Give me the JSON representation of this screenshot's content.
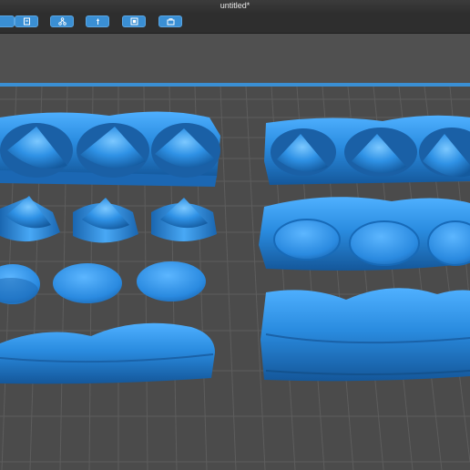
{
  "window": {
    "title": "untitled*"
  },
  "toolbar": {
    "buttons": [
      {
        "icon": "tool-icon"
      },
      {
        "icon": "document-icon"
      },
      {
        "icon": "network-icon"
      },
      {
        "icon": "support-icon"
      },
      {
        "icon": "frame-icon"
      },
      {
        "icon": "toolbox-icon"
      }
    ]
  },
  "colors": {
    "accent": "#3a8fd4",
    "model": "#2b8fe0",
    "plate": "#4b4b4b",
    "grid": "#5c5c5c"
  }
}
